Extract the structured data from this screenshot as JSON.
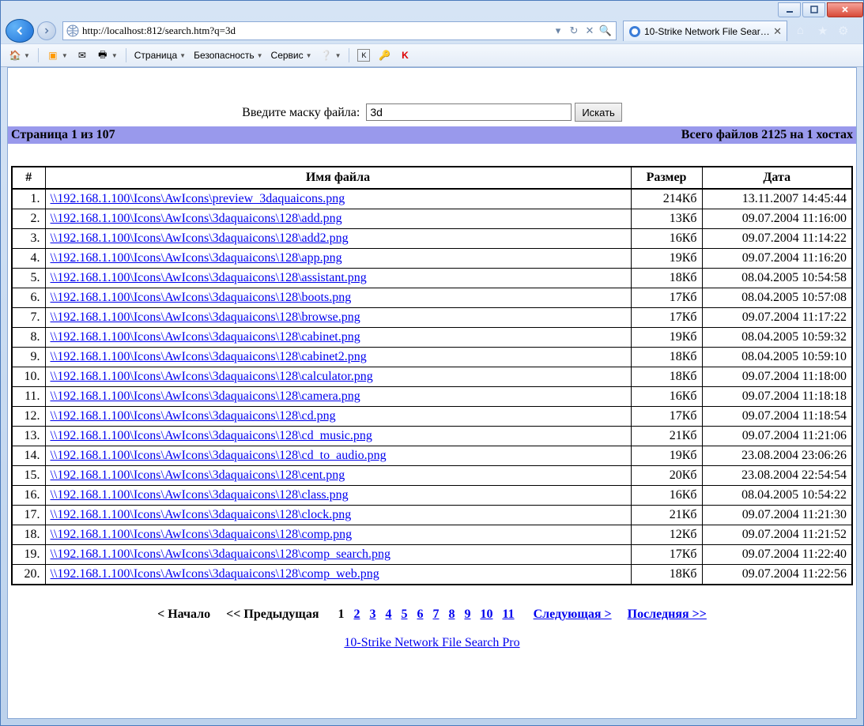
{
  "browser": {
    "url": "http://localhost:812/search.htm?q=3d",
    "url_display_prefix": "http://",
    "url_display_host": "localhost",
    "url_display_path": ":812/search.htm?q=3d",
    "tab_title": "10-Strike Network File Searc..."
  },
  "toolbar": {
    "page_label": "Страница",
    "security_label": "Безопасность",
    "service_label": "Сервис"
  },
  "search": {
    "label": "Введите маску файла:",
    "value": "3d",
    "button": "Искать"
  },
  "status": {
    "left": "Страница 1 из 107",
    "right": "Всего файлов 2125 на 1 хостах"
  },
  "columns": {
    "num": "#",
    "name": "Имя файла",
    "size": "Размер",
    "date": "Дата"
  },
  "rows": [
    {
      "n": "1.",
      "name": "\\\\192.168.1.100\\Icons\\AwIcons\\preview_3daquaicons.png",
      "size": "214Кб",
      "date": "13.11.2007 14:45:44"
    },
    {
      "n": "2.",
      "name": "\\\\192.168.1.100\\Icons\\AwIcons\\3daquaicons\\128\\add.png",
      "size": "13Кб",
      "date": "09.07.2004 11:16:00"
    },
    {
      "n": "3.",
      "name": "\\\\192.168.1.100\\Icons\\AwIcons\\3daquaicons\\128\\add2.png",
      "size": "16Кб",
      "date": "09.07.2004 11:14:22"
    },
    {
      "n": "4.",
      "name": "\\\\192.168.1.100\\Icons\\AwIcons\\3daquaicons\\128\\app.png",
      "size": "19Кб",
      "date": "09.07.2004 11:16:20"
    },
    {
      "n": "5.",
      "name": "\\\\192.168.1.100\\Icons\\AwIcons\\3daquaicons\\128\\assistant.png",
      "size": "18Кб",
      "date": "08.04.2005 10:54:58"
    },
    {
      "n": "6.",
      "name": "\\\\192.168.1.100\\Icons\\AwIcons\\3daquaicons\\128\\boots.png",
      "size": "17Кб",
      "date": "08.04.2005 10:57:08"
    },
    {
      "n": "7.",
      "name": "\\\\192.168.1.100\\Icons\\AwIcons\\3daquaicons\\128\\browse.png",
      "size": "17Кб",
      "date": "09.07.2004 11:17:22"
    },
    {
      "n": "8.",
      "name": "\\\\192.168.1.100\\Icons\\AwIcons\\3daquaicons\\128\\cabinet.png",
      "size": "19Кб",
      "date": "08.04.2005 10:59:32"
    },
    {
      "n": "9.",
      "name": "\\\\192.168.1.100\\Icons\\AwIcons\\3daquaicons\\128\\cabinet2.png",
      "size": "18Кб",
      "date": "08.04.2005 10:59:10"
    },
    {
      "n": "10.",
      "name": "\\\\192.168.1.100\\Icons\\AwIcons\\3daquaicons\\128\\calculator.png",
      "size": "18Кб",
      "date": "09.07.2004 11:18:00"
    },
    {
      "n": "11.",
      "name": "\\\\192.168.1.100\\Icons\\AwIcons\\3daquaicons\\128\\camera.png",
      "size": "16Кб",
      "date": "09.07.2004 11:18:18"
    },
    {
      "n": "12.",
      "name": "\\\\192.168.1.100\\Icons\\AwIcons\\3daquaicons\\128\\cd.png",
      "size": "17Кб",
      "date": "09.07.2004 11:18:54"
    },
    {
      "n": "13.",
      "name": "\\\\192.168.1.100\\Icons\\AwIcons\\3daquaicons\\128\\cd_music.png",
      "size": "21Кб",
      "date": "09.07.2004 11:21:06"
    },
    {
      "n": "14.",
      "name": "\\\\192.168.1.100\\Icons\\AwIcons\\3daquaicons\\128\\cd_to_audio.png",
      "size": "19Кб",
      "date": "23.08.2004 23:06:26"
    },
    {
      "n": "15.",
      "name": "\\\\192.168.1.100\\Icons\\AwIcons\\3daquaicons\\128\\cent.png",
      "size": "20Кб",
      "date": "23.08.2004 22:54:54"
    },
    {
      "n": "16.",
      "name": "\\\\192.168.1.100\\Icons\\AwIcons\\3daquaicons\\128\\class.png",
      "size": "16Кб",
      "date": "08.04.2005 10:54:22"
    },
    {
      "n": "17.",
      "name": "\\\\192.168.1.100\\Icons\\AwIcons\\3daquaicons\\128\\clock.png",
      "size": "21Кб",
      "date": "09.07.2004 11:21:30"
    },
    {
      "n": "18.",
      "name": "\\\\192.168.1.100\\Icons\\AwIcons\\3daquaicons\\128\\comp.png",
      "size": "12Кб",
      "date": "09.07.2004 11:21:52"
    },
    {
      "n": "19.",
      "name": "\\\\192.168.1.100\\Icons\\AwIcons\\3daquaicons\\128\\comp_search.png",
      "size": "17Кб",
      "date": "09.07.2004 11:22:40"
    },
    {
      "n": "20.",
      "name": "\\\\192.168.1.100\\Icons\\AwIcons\\3daquaicons\\128\\comp_web.png",
      "size": "18Кб",
      "date": "09.07.2004 11:22:56"
    }
  ],
  "pager": {
    "first": "< Начало",
    "prev": "<< Предыдущая",
    "pages": [
      "1",
      "2",
      "3",
      "4",
      "5",
      "6",
      "7",
      "8",
      "9",
      "10",
      "11"
    ],
    "current_index": 0,
    "next": "Следующая >",
    "last": "Последняя >>"
  },
  "footer": {
    "link": "10-Strike Network File Search Pro"
  }
}
